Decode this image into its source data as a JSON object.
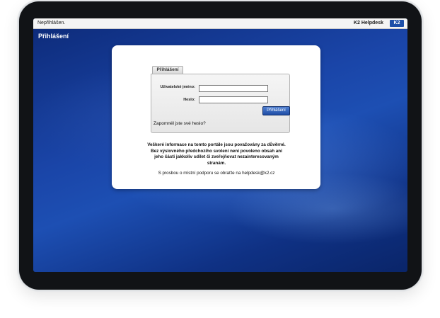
{
  "statusbar": {
    "login_status": "Nepřihlášen.",
    "app_name": "K2 Helpdesk",
    "logo_text": "K2"
  },
  "page": {
    "title": "Přihlášení"
  },
  "login": {
    "tab_label": "Přihlášení",
    "username_label": "Uživatelské jméno:",
    "password_label": "Heslo:",
    "username_value": "",
    "password_value": "",
    "submit_label": "Přihlášení",
    "forgot_link": "Zapomněl jste své heslo?"
  },
  "notice": {
    "text": "Veškeré informace na tomto portále jsou považovány za důvěrné. Bez výslovného předchozího svolení není povoleno obsah ani jeho části jakkoliv sdílet či zveřejňovat nezainteresovaným stranám.",
    "contact": "S prosbou o místní podporu se obraťte na helpdesk@k2.cz"
  },
  "colors": {
    "background": "#1a45a8",
    "button": "#1f4ea5",
    "logo": "#1d4fa8"
  }
}
